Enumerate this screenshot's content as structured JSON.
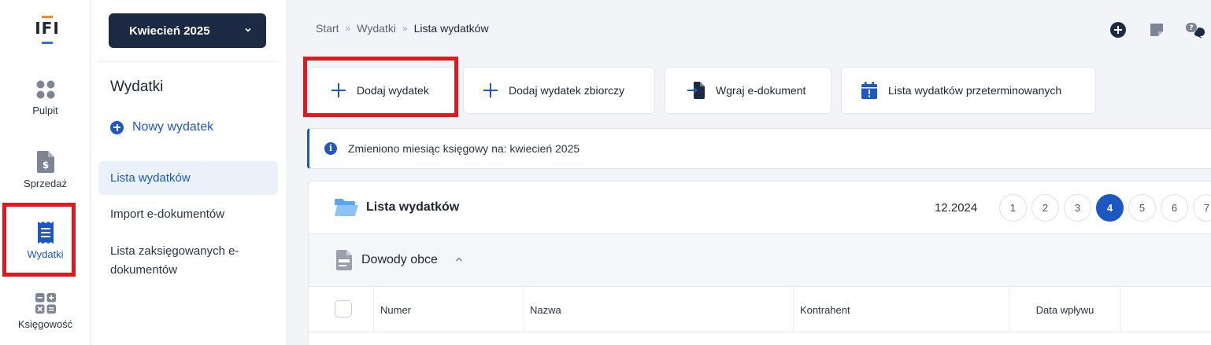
{
  "app": {
    "logo_text": "IFI"
  },
  "rail": {
    "items": [
      {
        "label": "Pulpit"
      },
      {
        "label": "Sprzedaż"
      },
      {
        "label": "Wydatki"
      },
      {
        "label": "Księgowość"
      }
    ]
  },
  "submenu": {
    "month_selector": "Kwiecień 2025",
    "title": "Wydatki",
    "new_expense": "Nowy wydatek",
    "items": [
      {
        "label": "Lista wydatków"
      },
      {
        "label": "Import e-dokumentów"
      },
      {
        "label": "Lista zaksięgowanych e-dokumentów"
      }
    ]
  },
  "breadcrumb": {
    "items": [
      "Start",
      "Wydatki",
      "Lista wydatków"
    ]
  },
  "actions": {
    "add_expense": "Dodaj wydatek",
    "add_collective": "Dodaj wydatek zbiorczy",
    "upload_edoc": "Wgraj e-dokument",
    "overdue_list": "Lista wydatków przeterminowanych"
  },
  "info": {
    "message": "Zmieniono miesiąc księgowy na: kwiecień 2025"
  },
  "panel": {
    "title": "Lista wydatków",
    "period": "12.2024",
    "pages": [
      "1",
      "2",
      "3",
      "4",
      "5",
      "6",
      "7"
    ],
    "active_page": "4",
    "section_title": "Dowody obce",
    "columns": [
      "Numer",
      "Nazwa",
      "Kontrahent",
      "Data wpływu"
    ]
  },
  "colors": {
    "accent": "#1d57c2",
    "navy": "#1d2a44",
    "highlight": "#e3181f"
  }
}
